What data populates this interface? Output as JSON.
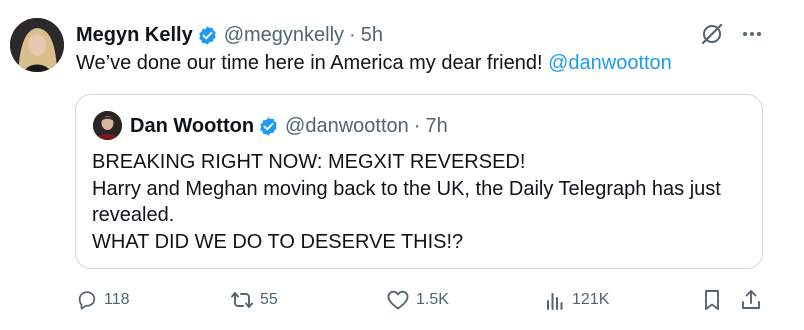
{
  "tweet": {
    "author": {
      "name": "Megyn Kelly",
      "handle": "@megynkelly",
      "time": "5h"
    },
    "text": "We’ve done our time here in America my dear friend!",
    "mention": "@danwootton",
    "icons": [
      "grok-icon",
      "more-icon"
    ]
  },
  "quoted": {
    "author": {
      "name": "Dan Wootton",
      "handle": "@danwootton",
      "time": "7h"
    },
    "lines": [
      "BREAKING RIGHT NOW: MEGXIT REVERSED!",
      "Harry and Meghan moving back to the UK, the Daily Telegraph has just",
      "revealed.",
      "WHAT DID WE DO TO DESERVE THIS!?"
    ]
  },
  "actions": {
    "replies": "118",
    "reposts": "55",
    "likes": "1.5K",
    "views": "121K"
  },
  "colors": {
    "accent": "#1d9bf0",
    "muted": "#536471",
    "border": "#cfd9de",
    "text": "#0f1419"
  }
}
